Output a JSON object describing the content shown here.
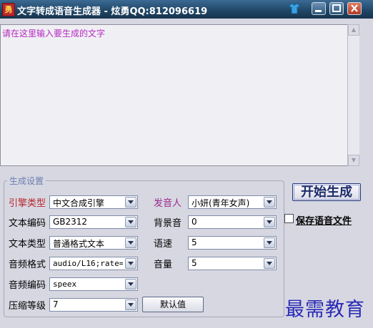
{
  "window": {
    "title": "文字转成语音生成器 - 炫勇QQ:812096619",
    "app_icon_glyph": "勇",
    "icons": [
      "shirt-icon",
      "minimize-icon",
      "maximize-icon",
      "close-icon"
    ]
  },
  "text_area": {
    "content": "请在这里输入要生成的文字"
  },
  "settings": {
    "legend": "生成设置",
    "fields": {
      "engine_type": {
        "label": "引擎类型",
        "value": "中文合成引擎"
      },
      "text_encoding": {
        "label": "文本编码",
        "value": "GB2312"
      },
      "text_type": {
        "label": "文本类型",
        "value": "普通格式文本"
      },
      "audio_format": {
        "label": "音频格式",
        "value": "audio/L16;rate="
      },
      "audio_encoding": {
        "label": "音频编码",
        "value": "speex"
      },
      "compression_level": {
        "label": "压缩等级",
        "value": "7"
      },
      "speaker": {
        "label": "发音人",
        "value": "小妍(青年女声)"
      },
      "background_sound": {
        "label": "背景音",
        "value": "0"
      },
      "speed": {
        "label": "语速",
        "value": "5"
      },
      "volume": {
        "label": "音量",
        "value": "5"
      }
    },
    "default_button": "默认值"
  },
  "actions": {
    "start_button": "开始生成",
    "save_checkbox_label": "保存语音文件",
    "save_checked": false
  },
  "watermark": "最需教育",
  "colors": {
    "title_bar": "#1f4565",
    "window_bg": "#d7d7e2",
    "placeholder_text": "#b428c0",
    "red_label": "#b8262d",
    "purple_label": "#9a2a8a",
    "watermark": "#2a2ab6"
  }
}
